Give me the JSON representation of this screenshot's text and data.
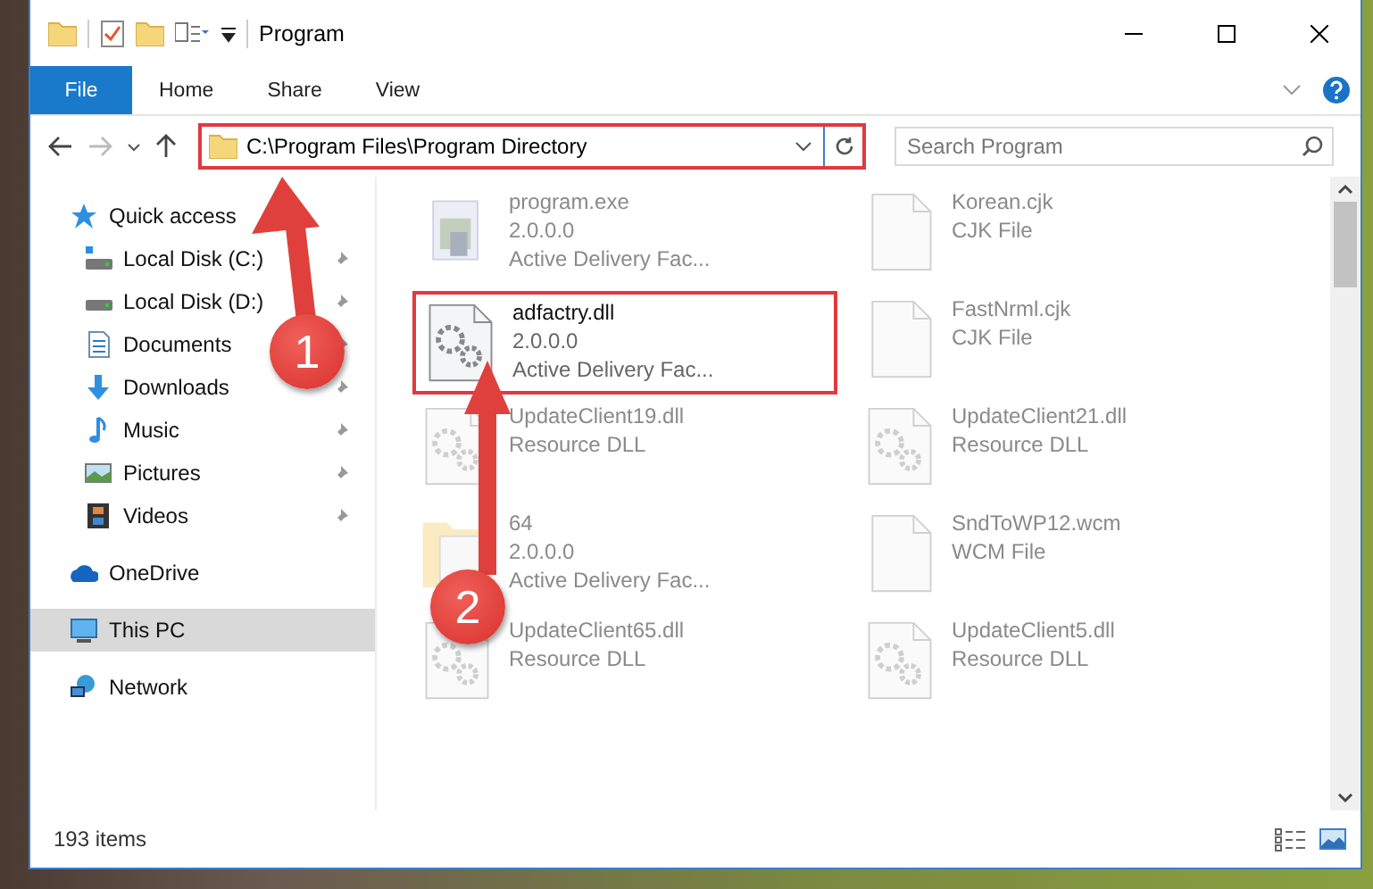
{
  "window": {
    "title": "Program"
  },
  "ribbon_tabs": [
    {
      "label": "File",
      "kind": "menu"
    },
    {
      "label": "Home",
      "kind": "tab"
    },
    {
      "label": "Share",
      "kind": "tab"
    },
    {
      "label": "View",
      "kind": "tab"
    }
  ],
  "address_bar": {
    "path": "C:\\Program Files\\Program Directory",
    "highlighted": true
  },
  "search": {
    "placeholder": "Search Program"
  },
  "sidebar": {
    "items": [
      {
        "label": "Quick access",
        "selected": false,
        "children": [
          {
            "label": "Local Disk (C:)",
            "pinned": true,
            "selected": false
          },
          {
            "label": "Local Disk (D:)",
            "pinned": true,
            "selected": false
          },
          {
            "label": "Documents",
            "pinned": true,
            "selected": false
          },
          {
            "label": "Downloads",
            "pinned": true,
            "selected": false
          },
          {
            "label": "Music",
            "pinned": true,
            "selected": false
          },
          {
            "label": "Pictures",
            "pinned": true,
            "selected": false
          },
          {
            "label": "Videos",
            "pinned": true,
            "selected": false
          }
        ]
      },
      {
        "label": "OneDrive",
        "selected": false
      },
      {
        "label": "This PC",
        "selected": true
      },
      {
        "label": "Network",
        "selected": false
      }
    ]
  },
  "files": [
    {
      "name": "program.exe",
      "details": [
        "2.0.0.0",
        "Active Delivery Fac..."
      ],
      "kind": "exe",
      "dimmed": true,
      "highlighted": false
    },
    {
      "name": "Korean.cjk",
      "details": [
        "CJK File"
      ],
      "kind": "file",
      "dimmed": true,
      "highlighted": false
    },
    {
      "name": "adfactry.dll",
      "details": [
        "2.0.0.0",
        "Active Delivery Fac..."
      ],
      "kind": "dll",
      "dimmed": false,
      "highlighted": true
    },
    {
      "name": "FastNrml.cjk",
      "details": [
        "CJK File"
      ],
      "kind": "file",
      "dimmed": true,
      "highlighted": false
    },
    {
      "name": "UpdateClient19.dll",
      "details": [
        "Resource DLL"
      ],
      "kind": "dll",
      "dimmed": true,
      "highlighted": false
    },
    {
      "name": "UpdateClient21.dll",
      "details": [
        "Resource DLL"
      ],
      "kind": "dll",
      "dimmed": true,
      "highlighted": false
    },
    {
      "name": "64",
      "details": [
        "2.0.0.0",
        "Active Delivery Fac..."
      ],
      "kind": "folder",
      "dimmed": true,
      "highlighted": false
    },
    {
      "name": "SndToWP12.wcm",
      "details": [
        "WCM File"
      ],
      "kind": "file",
      "dimmed": true,
      "highlighted": false
    },
    {
      "name": "UpdateClient65.dll",
      "details": [
        "Resource DLL"
      ],
      "kind": "dll",
      "dimmed": true,
      "highlighted": false
    },
    {
      "name": "UpdateClient5.dll",
      "details": [
        "Resource DLL"
      ],
      "kind": "dll",
      "dimmed": true,
      "highlighted": false
    }
  ],
  "callouts": [
    {
      "number": "1"
    },
    {
      "number": "2"
    }
  ],
  "status_bar": {
    "item_count": "193 items"
  }
}
